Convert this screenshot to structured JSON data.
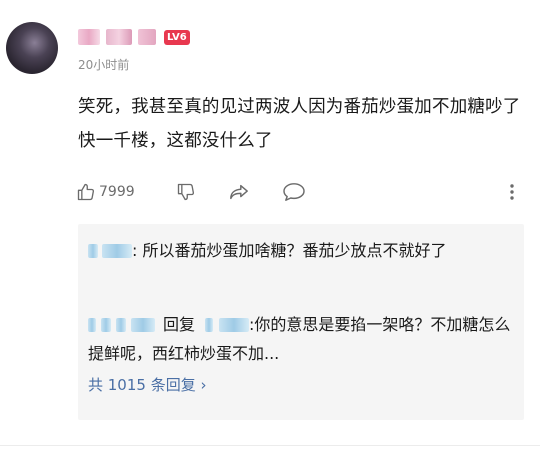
{
  "comment": {
    "user_level_badge": "LV6",
    "timestamp": "20小时前",
    "text": "笑死，我甚至真的见过两波人因为番茄炒蛋加不加糖吵了快一千楼，这都没什么了",
    "like_count": "7999"
  },
  "replies": [
    {
      "text": ": 所以番茄炒蛋加啥糖？番茄少放点不就好了"
    },
    {
      "reply_word": "回复",
      "text": ":你的意思是要掐一架咯？不加糖怎么提鲜呢，西红柿炒蛋不加..."
    }
  ],
  "replies_summary": {
    "label": "共 1015 条回复",
    "chevron": "›"
  },
  "icons": {
    "like": "thumbs-up-icon",
    "dislike": "thumbs-down-icon",
    "share": "share-arrow-icon",
    "comment": "speech-bubble-icon",
    "more": "vertical-dots-icon"
  },
  "colors": {
    "badge": "#e8384f",
    "link": "#4a6fa5",
    "muted": "#8e8e8e"
  }
}
